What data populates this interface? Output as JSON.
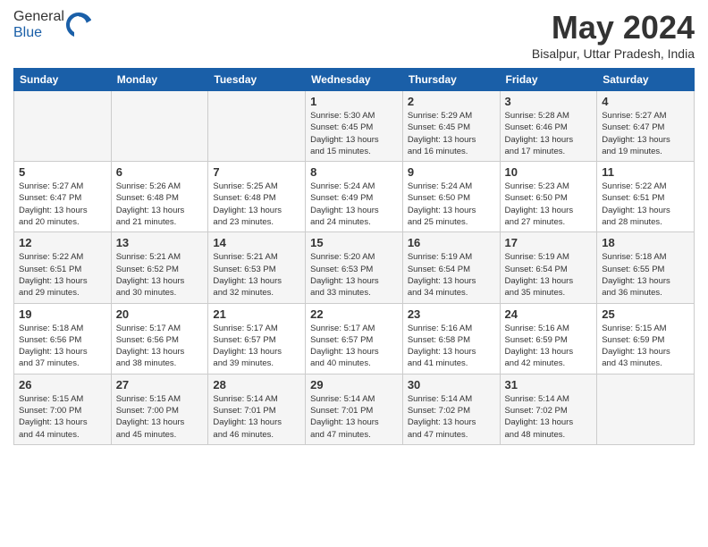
{
  "header": {
    "logo_general": "General",
    "logo_blue": "Blue",
    "month_title": "May 2024",
    "location": "Bisalpur, Uttar Pradesh, India"
  },
  "days_of_week": [
    "Sunday",
    "Monday",
    "Tuesday",
    "Wednesday",
    "Thursday",
    "Friday",
    "Saturday"
  ],
  "weeks": [
    [
      {
        "day": "",
        "info": ""
      },
      {
        "day": "",
        "info": ""
      },
      {
        "day": "",
        "info": ""
      },
      {
        "day": "1",
        "info": "Sunrise: 5:30 AM\nSunset: 6:45 PM\nDaylight: 13 hours\nand 15 minutes."
      },
      {
        "day": "2",
        "info": "Sunrise: 5:29 AM\nSunset: 6:45 PM\nDaylight: 13 hours\nand 16 minutes."
      },
      {
        "day": "3",
        "info": "Sunrise: 5:28 AM\nSunset: 6:46 PM\nDaylight: 13 hours\nand 17 minutes."
      },
      {
        "day": "4",
        "info": "Sunrise: 5:27 AM\nSunset: 6:47 PM\nDaylight: 13 hours\nand 19 minutes."
      }
    ],
    [
      {
        "day": "5",
        "info": "Sunrise: 5:27 AM\nSunset: 6:47 PM\nDaylight: 13 hours\nand 20 minutes."
      },
      {
        "day": "6",
        "info": "Sunrise: 5:26 AM\nSunset: 6:48 PM\nDaylight: 13 hours\nand 21 minutes."
      },
      {
        "day": "7",
        "info": "Sunrise: 5:25 AM\nSunset: 6:48 PM\nDaylight: 13 hours\nand 23 minutes."
      },
      {
        "day": "8",
        "info": "Sunrise: 5:24 AM\nSunset: 6:49 PM\nDaylight: 13 hours\nand 24 minutes."
      },
      {
        "day": "9",
        "info": "Sunrise: 5:24 AM\nSunset: 6:50 PM\nDaylight: 13 hours\nand 25 minutes."
      },
      {
        "day": "10",
        "info": "Sunrise: 5:23 AM\nSunset: 6:50 PM\nDaylight: 13 hours\nand 27 minutes."
      },
      {
        "day": "11",
        "info": "Sunrise: 5:22 AM\nSunset: 6:51 PM\nDaylight: 13 hours\nand 28 minutes."
      }
    ],
    [
      {
        "day": "12",
        "info": "Sunrise: 5:22 AM\nSunset: 6:51 PM\nDaylight: 13 hours\nand 29 minutes."
      },
      {
        "day": "13",
        "info": "Sunrise: 5:21 AM\nSunset: 6:52 PM\nDaylight: 13 hours\nand 30 minutes."
      },
      {
        "day": "14",
        "info": "Sunrise: 5:21 AM\nSunset: 6:53 PM\nDaylight: 13 hours\nand 32 minutes."
      },
      {
        "day": "15",
        "info": "Sunrise: 5:20 AM\nSunset: 6:53 PM\nDaylight: 13 hours\nand 33 minutes."
      },
      {
        "day": "16",
        "info": "Sunrise: 5:19 AM\nSunset: 6:54 PM\nDaylight: 13 hours\nand 34 minutes."
      },
      {
        "day": "17",
        "info": "Sunrise: 5:19 AM\nSunset: 6:54 PM\nDaylight: 13 hours\nand 35 minutes."
      },
      {
        "day": "18",
        "info": "Sunrise: 5:18 AM\nSunset: 6:55 PM\nDaylight: 13 hours\nand 36 minutes."
      }
    ],
    [
      {
        "day": "19",
        "info": "Sunrise: 5:18 AM\nSunset: 6:56 PM\nDaylight: 13 hours\nand 37 minutes."
      },
      {
        "day": "20",
        "info": "Sunrise: 5:17 AM\nSunset: 6:56 PM\nDaylight: 13 hours\nand 38 minutes."
      },
      {
        "day": "21",
        "info": "Sunrise: 5:17 AM\nSunset: 6:57 PM\nDaylight: 13 hours\nand 39 minutes."
      },
      {
        "day": "22",
        "info": "Sunrise: 5:17 AM\nSunset: 6:57 PM\nDaylight: 13 hours\nand 40 minutes."
      },
      {
        "day": "23",
        "info": "Sunrise: 5:16 AM\nSunset: 6:58 PM\nDaylight: 13 hours\nand 41 minutes."
      },
      {
        "day": "24",
        "info": "Sunrise: 5:16 AM\nSunset: 6:59 PM\nDaylight: 13 hours\nand 42 minutes."
      },
      {
        "day": "25",
        "info": "Sunrise: 5:15 AM\nSunset: 6:59 PM\nDaylight: 13 hours\nand 43 minutes."
      }
    ],
    [
      {
        "day": "26",
        "info": "Sunrise: 5:15 AM\nSunset: 7:00 PM\nDaylight: 13 hours\nand 44 minutes."
      },
      {
        "day": "27",
        "info": "Sunrise: 5:15 AM\nSunset: 7:00 PM\nDaylight: 13 hours\nand 45 minutes."
      },
      {
        "day": "28",
        "info": "Sunrise: 5:14 AM\nSunset: 7:01 PM\nDaylight: 13 hours\nand 46 minutes."
      },
      {
        "day": "29",
        "info": "Sunrise: 5:14 AM\nSunset: 7:01 PM\nDaylight: 13 hours\nand 47 minutes."
      },
      {
        "day": "30",
        "info": "Sunrise: 5:14 AM\nSunset: 7:02 PM\nDaylight: 13 hours\nand 47 minutes."
      },
      {
        "day": "31",
        "info": "Sunrise: 5:14 AM\nSunset: 7:02 PM\nDaylight: 13 hours\nand 48 minutes."
      },
      {
        "day": "",
        "info": ""
      }
    ]
  ]
}
